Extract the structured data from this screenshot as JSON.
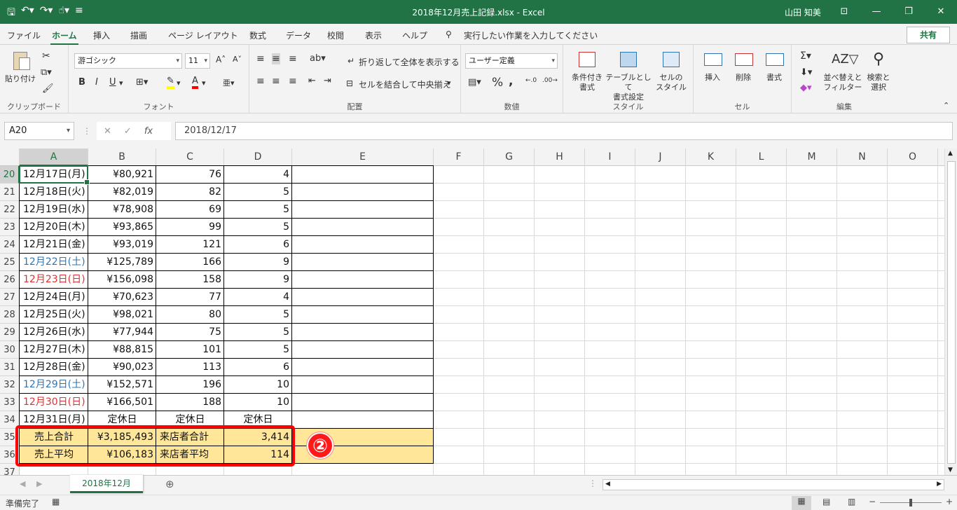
{
  "title": "2018年12月売上記録.xlsx  -  Excel",
  "user": "山田 知美",
  "tabs": [
    "ファイル",
    "ホーム",
    "挿入",
    "描画",
    "ページ レイアウト",
    "数式",
    "データ",
    "校閲",
    "表示",
    "ヘルプ"
  ],
  "tell_me": "実行したい作業を入力してください",
  "share": "共有",
  "ribbon": {
    "clipboard": {
      "label": "クリップボード",
      "paste": "貼り付け"
    },
    "font": {
      "label": "フォント",
      "name": "游ゴシック",
      "size": "11",
      "bold": "B",
      "italic": "I",
      "underline": "U"
    },
    "alignment": {
      "label": "配置",
      "wrap": "折り返して全体を表示する",
      "merge": "セルを結合して中央揃え"
    },
    "number": {
      "label": "数値",
      "format": "ユーザー定義",
      "percent": "%",
      "comma": ","
    },
    "styles": {
      "label": "スタイル",
      "cond": [
        "条件付き",
        "書式"
      ],
      "table": [
        "テーブルとして",
        "書式設定"
      ],
      "cell": [
        "セルの",
        "スタイル"
      ]
    },
    "cells": {
      "label": "セル",
      "insert": "挿入",
      "delete": "削除",
      "format": "書式"
    },
    "editing": {
      "label": "編集",
      "sort": [
        "並べ替えと",
        "フィルター"
      ],
      "find": [
        "検索と",
        "選択"
      ]
    }
  },
  "namebox": "A20",
  "formula": "2018/12/17",
  "columns": [
    "A",
    "B",
    "C",
    "D",
    "E",
    "F",
    "G",
    "H",
    "I",
    "J",
    "K",
    "L",
    "M",
    "N",
    "O"
  ],
  "rows": [
    {
      "n": "20",
      "a": "12月17日(月)",
      "b": "¥80,921",
      "c": "76",
      "d": "4",
      "t": ""
    },
    {
      "n": "21",
      "a": "12月18日(火)",
      "b": "¥82,019",
      "c": "82",
      "d": "5",
      "t": ""
    },
    {
      "n": "22",
      "a": "12月19日(水)",
      "b": "¥78,908",
      "c": "69",
      "d": "5",
      "t": ""
    },
    {
      "n": "23",
      "a": "12月20日(木)",
      "b": "¥93,865",
      "c": "99",
      "d": "5",
      "t": ""
    },
    {
      "n": "24",
      "a": "12月21日(金)",
      "b": "¥93,019",
      "c": "121",
      "d": "6",
      "t": ""
    },
    {
      "n": "25",
      "a": "12月22日(土)",
      "b": "¥125,789",
      "c": "166",
      "d": "9",
      "t": "sat"
    },
    {
      "n": "26",
      "a": "12月23日(日)",
      "b": "¥156,098",
      "c": "158",
      "d": "9",
      "t": "sun"
    },
    {
      "n": "27",
      "a": "12月24日(月)",
      "b": "¥70,623",
      "c": "77",
      "d": "4",
      "t": ""
    },
    {
      "n": "28",
      "a": "12月25日(火)",
      "b": "¥98,021",
      "c": "80",
      "d": "5",
      "t": ""
    },
    {
      "n": "29",
      "a": "12月26日(水)",
      "b": "¥77,944",
      "c": "75",
      "d": "5",
      "t": ""
    },
    {
      "n": "30",
      "a": "12月27日(木)",
      "b": "¥88,815",
      "c": "101",
      "d": "5",
      "t": ""
    },
    {
      "n": "31",
      "a": "12月28日(金)",
      "b": "¥90,023",
      "c": "113",
      "d": "6",
      "t": ""
    },
    {
      "n": "32",
      "a": "12月29日(土)",
      "b": "¥152,571",
      "c": "196",
      "d": "10",
      "t": "sat"
    },
    {
      "n": "33",
      "a": "12月30日(日)",
      "b": "¥166,501",
      "c": "188",
      "d": "10",
      "t": "sun"
    },
    {
      "n": "34",
      "a": "12月31日(月)",
      "b": "定休日",
      "c": "定休日",
      "d": "定休日",
      "t": "closed"
    },
    {
      "n": "35",
      "a": "売上合計",
      "b": "¥3,185,493",
      "c": "来店者合計",
      "d": "3,414",
      "t": "sum"
    },
    {
      "n": "36",
      "a": "売上平均",
      "b": "¥106,183",
      "c": "来店者平均",
      "d": "114",
      "t": "sum"
    },
    {
      "n": "37",
      "a": "",
      "b": "",
      "c": "",
      "d": "",
      "t": "empty"
    }
  ],
  "badge": "②",
  "sheet_tab": "2018年12月",
  "status": "準備完了"
}
